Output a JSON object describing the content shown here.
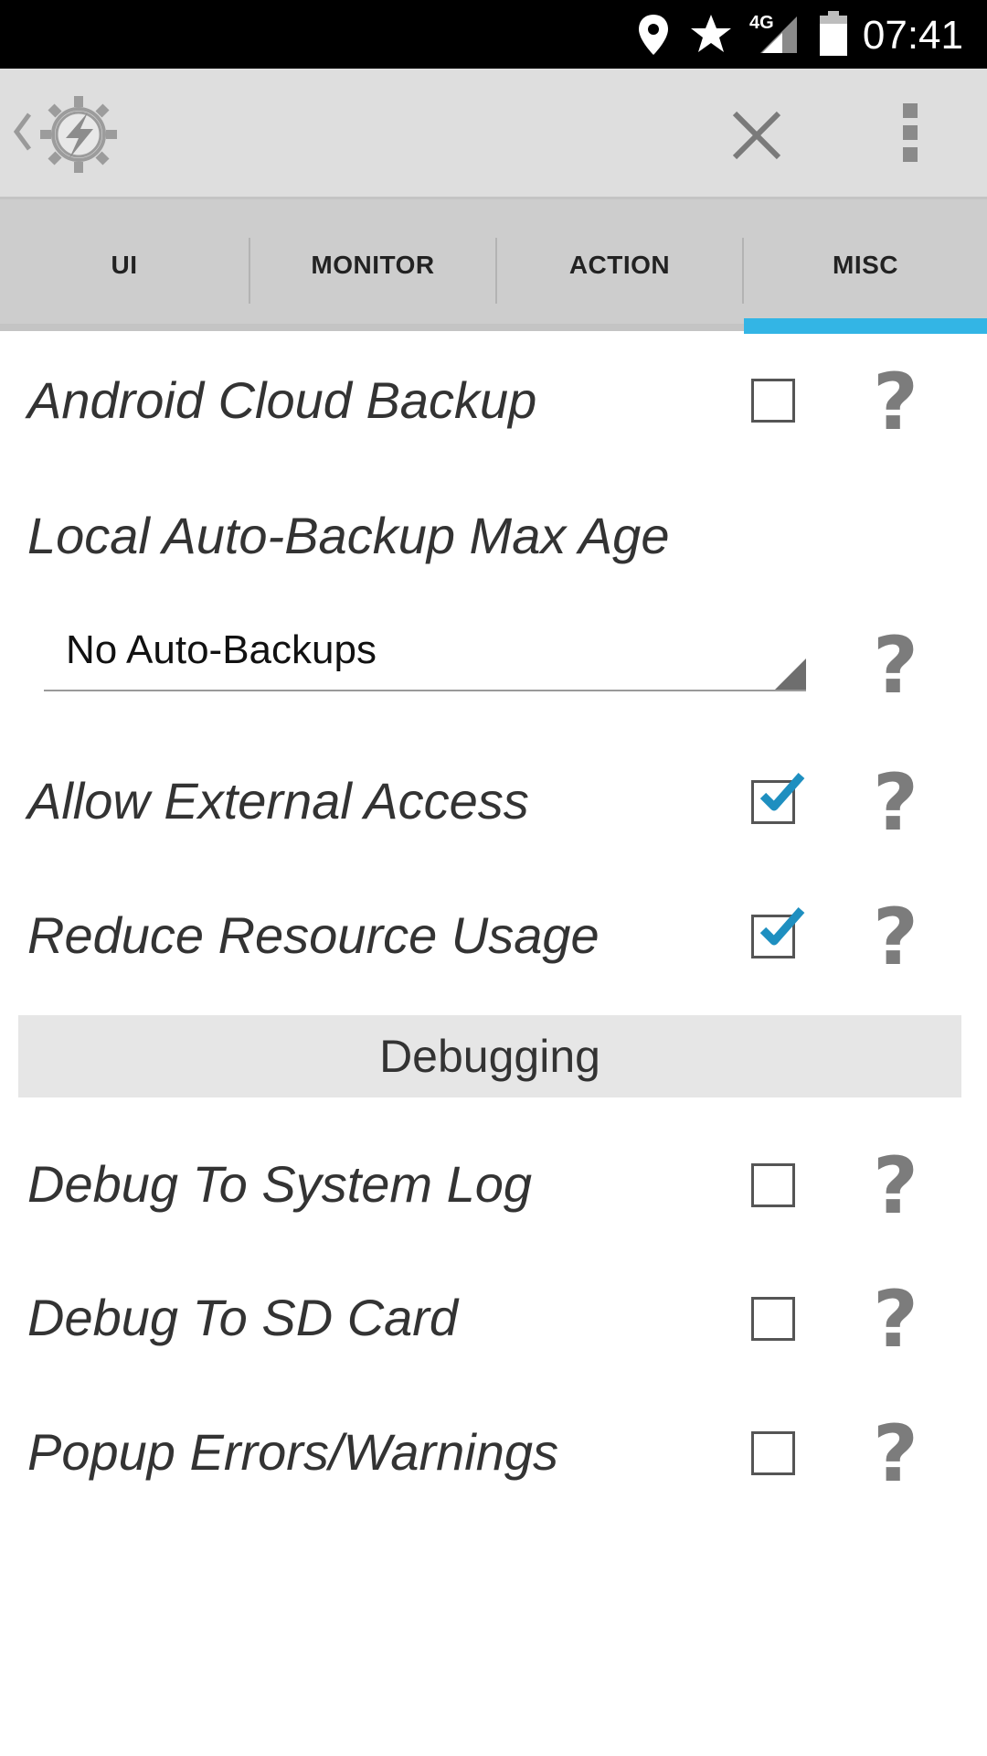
{
  "status_bar": {
    "time": "07:41",
    "network_label": "4G",
    "icons": [
      "location-icon",
      "star-icon",
      "signal-icon",
      "battery-icon"
    ]
  },
  "action_bar": {
    "back_icon": "chevron-left-icon",
    "logo_icon": "gear-lightning-icon",
    "close_icon": "close-icon",
    "overflow_icon": "more-vert-icon"
  },
  "tabs": [
    {
      "label": "UI",
      "selected": false
    },
    {
      "label": "MONITOR",
      "selected": false
    },
    {
      "label": "ACTION",
      "selected": false
    },
    {
      "label": "MISC",
      "selected": true
    }
  ],
  "accent_color": "#33b5e5",
  "settings": {
    "android_cloud_backup": {
      "label": "Android Cloud Backup",
      "checked": false
    },
    "local_auto_backup": {
      "label": "Local Auto-Backup Max Age",
      "value": "No Auto-Backups"
    },
    "allow_external_access": {
      "label": "Allow External Access",
      "checked": true
    },
    "reduce_resource_usage": {
      "label": "Reduce Resource Usage",
      "checked": true
    },
    "debugging_header": "Debugging",
    "debug_system_log": {
      "label": "Debug To System Log",
      "checked": false
    },
    "debug_sd_card": {
      "label": "Debug To SD Card",
      "checked": false
    },
    "popup_errors": {
      "label": "Popup Errors/Warnings",
      "checked": false
    }
  },
  "help_glyph": "?"
}
